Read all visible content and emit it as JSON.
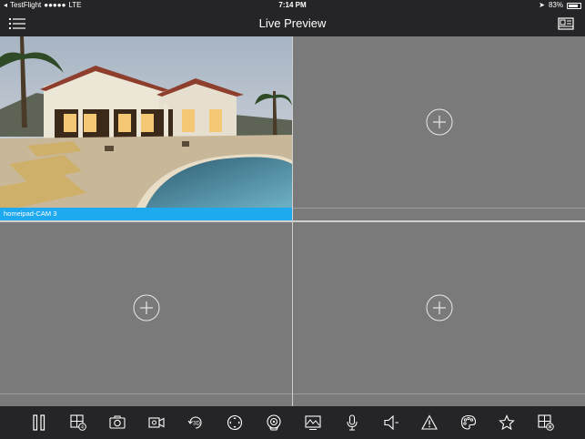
{
  "status": {
    "carrier": "TestFlight",
    "signal": "●●●●●",
    "network": "LTE",
    "time": "7:14 PM",
    "battery": "83%"
  },
  "nav": {
    "title": "Live Preview",
    "menu_icon": "list-icon",
    "layout_icon": "channel-layout-icon"
  },
  "cells": [
    {
      "label": "homeipad-CAM 3",
      "active": true,
      "has_video": true
    },
    {
      "label": "",
      "active": false,
      "has_video": false
    },
    {
      "label": "",
      "active": false,
      "has_video": false
    },
    {
      "label": "",
      "active": false,
      "has_video": false
    }
  ],
  "toolbar": {
    "items": [
      "pause-icon",
      "window-split-icon",
      "snapshot-icon",
      "record-icon",
      "3d-position-icon",
      "fisheye-icon",
      "ptz-icon",
      "image-adjust-icon",
      "talk-icon",
      "audio-icon",
      "alarm-icon",
      "color-icon",
      "favorite-icon",
      "close-all-icon"
    ],
    "label_3d": "3D"
  },
  "colors": {
    "accent": "#1fa9ef",
    "background": "#252527",
    "cell": "#7a7a7a"
  }
}
